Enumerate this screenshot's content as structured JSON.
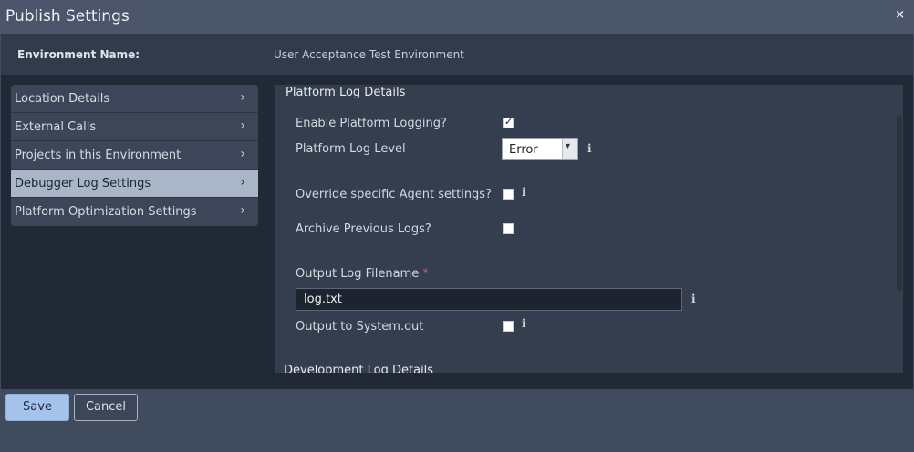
{
  "window": {
    "title": "Publish Settings",
    "close_label": "×"
  },
  "environment": {
    "label": "Environment Name:",
    "value": "User Acceptance Test Environment"
  },
  "nav": {
    "items": [
      {
        "label": "Location Details",
        "chevron": "›",
        "active": false
      },
      {
        "label": "External Calls",
        "chevron": "›",
        "active": false
      },
      {
        "label": "Projects in this Environment",
        "chevron": "›",
        "active": false
      },
      {
        "label": "Debugger Log Settings",
        "chevron": "›",
        "active": true
      },
      {
        "label": "Platform Optimization Settings",
        "chevron": "›",
        "active": false
      }
    ]
  },
  "panel": {
    "section_title": "Platform Log Details",
    "section2_title": "Development Log Details",
    "enable_logging": {
      "label": "Enable Platform Logging?",
      "checked": true,
      "mark": "✓"
    },
    "log_level": {
      "label": "Platform Log Level",
      "value": "Error",
      "arrow": "▾"
    },
    "override_agent": {
      "label": "Override specific Agent settings?",
      "checked": false
    },
    "archive_logs": {
      "label": "Archive Previous Logs?",
      "checked": false
    },
    "output_filename": {
      "label": "Output Log Filename",
      "required_marker": "*",
      "value": "log.txt"
    },
    "output_system": {
      "label": "Output to System.out",
      "checked": false
    },
    "info_glyph": "i"
  },
  "footer": {
    "save_label": "Save",
    "cancel_label": "Cancel"
  }
}
